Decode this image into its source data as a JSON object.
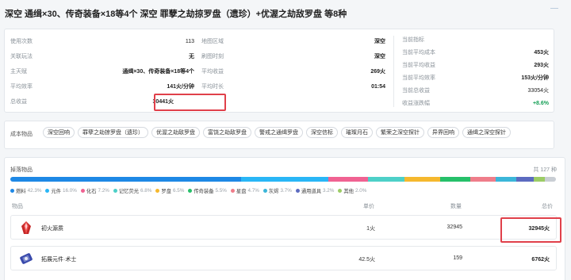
{
  "header": {
    "title": "深空 通缉×30、传奇装备×18等4个 深空 罪孽之劫掠罗盘（遗珍）+优渥之劫敌罗盘 等8种"
  },
  "stats": {
    "left": [
      {
        "label": "使用次数",
        "value": "113"
      },
      {
        "label": "关联玩法",
        "value": "无"
      },
      {
        "label": "主天赋",
        "value": "通缉×30、传奇装备×18等4个"
      },
      {
        "label": "平均效率",
        "value": "141火/分钟"
      },
      {
        "label": "总收益",
        "value": "30441火"
      }
    ],
    "middle": [
      {
        "label": "地图区域",
        "value": "深空"
      },
      {
        "label": "刷图时刻",
        "value": "深空"
      },
      {
        "label": "平均收益",
        "value": "269火"
      },
      {
        "label": "平均时长",
        "value": "01:54"
      }
    ],
    "right_title": "当前指标",
    "right": [
      {
        "label": "当前平均成本",
        "value": "453火"
      },
      {
        "label": "当前平均收益",
        "value": "293火"
      },
      {
        "label": "当前平均效率",
        "value": "153火/分钟"
      },
      {
        "label": "当前总收益",
        "value": "33054火"
      },
      {
        "label": "收益涨跌幅",
        "value": "+8.6%"
      }
    ]
  },
  "cost": {
    "label": "成本物品",
    "tags": [
      "深空回响",
      "罪孽之劫掠罗盘（遗珍）",
      "优渥之劫敌罗盘",
      "富饶之劫敌罗盘",
      "警戒之通缉罗盘",
      "深空信标",
      "璀璨月石",
      "繁荣之深空探针",
      "异界回响",
      "通缉之深空探针"
    ]
  },
  "drops": {
    "label": "掉落物品",
    "total": "共 127 种",
    "bar": [
      {
        "color": "#1e88e5",
        "pct": 42.3
      },
      {
        "color": "#29b6f6",
        "pct": 16.0
      },
      {
        "color": "#f06292",
        "pct": 7.2
      },
      {
        "color": "#4dd0c8",
        "pct": 6.8
      },
      {
        "color": "#f5b82e",
        "pct": 6.5
      },
      {
        "color": "#26c06a",
        "pct": 5.5
      },
      {
        "color": "#ef7d8a",
        "pct": 4.7
      },
      {
        "color": "#3bb6d9",
        "pct": 3.7
      },
      {
        "color": "#5c6bc0",
        "pct": 3.2
      },
      {
        "color": "#9ccc65",
        "pct": 2.0
      },
      {
        "color": "#c9ced4",
        "pct": 2.1
      }
    ],
    "legend": [
      {
        "name": "燃料",
        "pct": "42.3%",
        "color": "#1e88e5"
      },
      {
        "name": "元件",
        "pct": "16.0%",
        "color": "#29b6f6"
      },
      {
        "name": "化石",
        "pct": "7.2%",
        "color": "#f06292"
      },
      {
        "name": "记忆荧光",
        "pct": "6.8%",
        "color": "#4dd0c8"
      },
      {
        "name": "罗盘",
        "pct": "6.5%",
        "color": "#f5b82e"
      },
      {
        "name": "传奇装备",
        "pct": "5.5%",
        "color": "#26c06a"
      },
      {
        "name": "星盘",
        "pct": "4.7%",
        "color": "#ef7d8a"
      },
      {
        "name": "灰烬",
        "pct": "3.7%",
        "color": "#3bb6d9"
      },
      {
        "name": "通用道具",
        "pct": "3.2%",
        "color": "#5c6bc0"
      },
      {
        "name": "其他",
        "pct": "2.0%",
        "color": "#9ccc65"
      }
    ],
    "columns": {
      "item": "物品",
      "price": "单价",
      "qty": "数量",
      "total": "总价"
    },
    "rows": [
      {
        "icon": "red-crystal-icon",
        "name": "初火源质",
        "price": "1火",
        "qty": "32945",
        "total": "32945火"
      },
      {
        "icon": "blue-part-icon",
        "name": "拓展元件·术士",
        "price": "42.5火",
        "qty": "159",
        "total": "6762火"
      }
    ]
  }
}
